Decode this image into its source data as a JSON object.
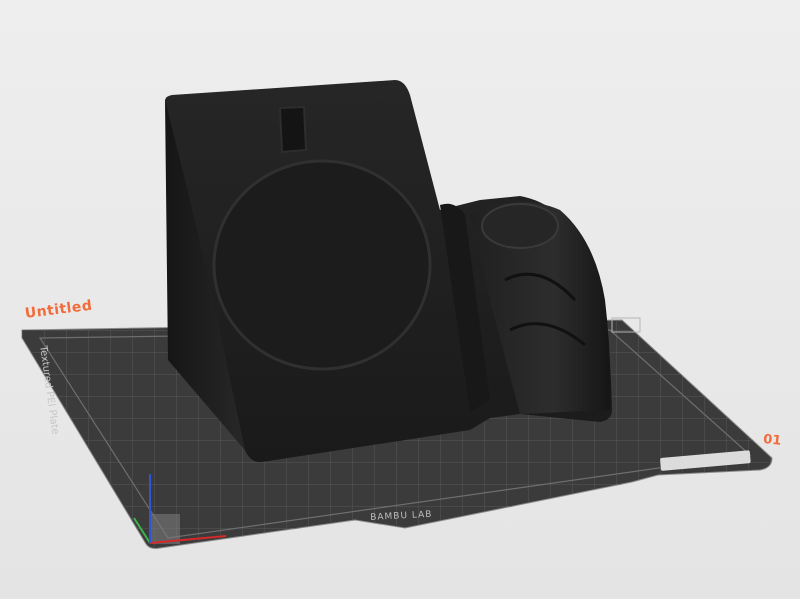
{
  "plate": {
    "label": "Untitled",
    "number": "01"
  },
  "bed": {
    "name": "Textured PEI Plate",
    "brand": "BAMBU LAB"
  },
  "colors": {
    "background": "#e9e9e9",
    "bed_surface": "#3b3b3b",
    "model": "#1e1e1e",
    "accent": "#f26b3a"
  },
  "axes_icon": {
    "x_color": "#d62828",
    "y_color": "#3cb44b",
    "z_color": "#2f55d4"
  }
}
